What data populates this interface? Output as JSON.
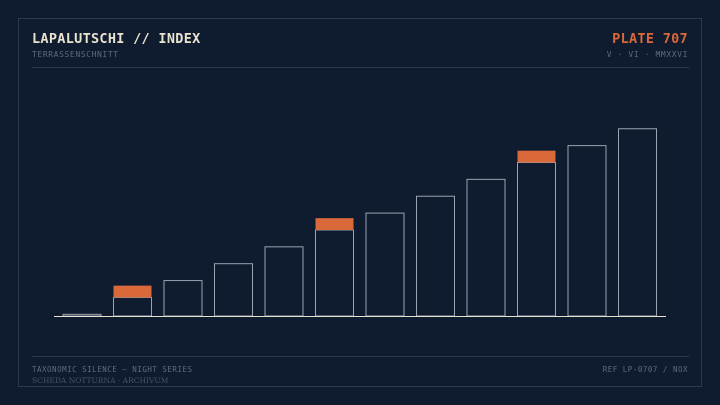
{
  "header": {
    "title": "LAPALUTSCHI // INDEX",
    "subtitle": "TERRASSENSCHNITT",
    "plate": "PLATE 707",
    "date": "V · VI · MMXXVI"
  },
  "footer": {
    "series": "TAXONOMIC SILENCE — NIGHT SERIES",
    "archive": "SCHEDA NOTTURNA · ARCHIVUM",
    "ref": "REF LP-0707 / NOX"
  },
  "colors": {
    "background": "#0f1b2e",
    "bar_outline": "#9aa3b2",
    "accent": "#d9683a",
    "baseline": "#e9e2cf"
  },
  "chart_data": {
    "type": "bar",
    "title": "",
    "xlabel": "",
    "ylabel": "",
    "ylim": [
      0,
      11.5
    ],
    "grid": false,
    "legend": "none",
    "values": [
      0.1,
      1.1,
      2.1,
      3.1,
      4.1,
      5.1,
      6.1,
      7.1,
      8.1,
      9.1,
      10.1,
      11.1
    ],
    "accent_bands": [
      {
        "index": 1,
        "from": 1.1,
        "to": 1.8
      },
      {
        "index": 5,
        "from": 5.1,
        "to": 5.8
      },
      {
        "index": 9,
        "from": 9.1,
        "to": 9.8
      }
    ]
  }
}
